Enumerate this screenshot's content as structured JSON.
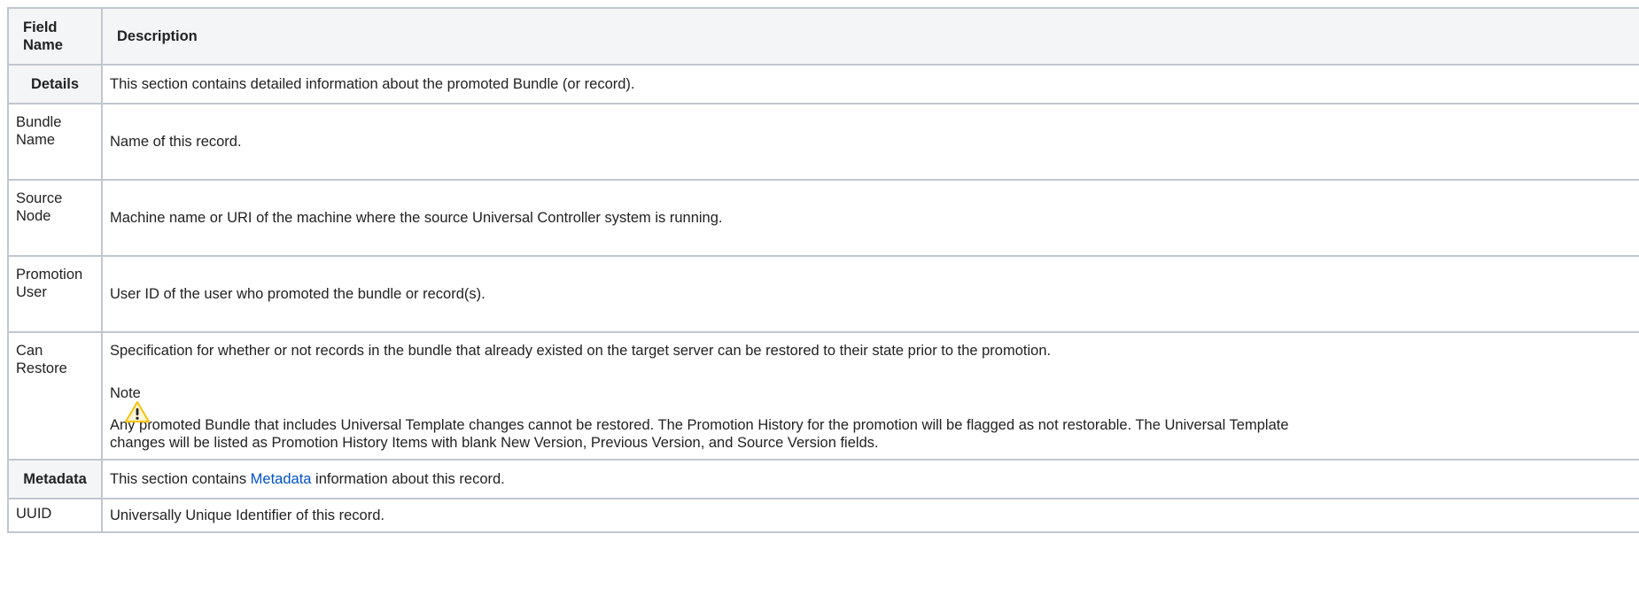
{
  "headers": {
    "field_name": "Field Name",
    "description": "Description"
  },
  "rows": {
    "details": {
      "label": "Details",
      "description": "This section contains detailed information about the promoted Bundle (or record)."
    },
    "bundle_name": {
      "label": "Bundle Name",
      "description": "Name of this record."
    },
    "source_node": {
      "label": "Source Node",
      "description": "Machine name or URI of the machine where the source Universal Controller system is running."
    },
    "promotion_user": {
      "label": "Promotion User",
      "description": "User ID of the user who promoted the bundle or record(s)."
    },
    "can_restore": {
      "label": "Can Restore",
      "description": "Specification for whether or not records in the bundle that already existed on the target server can be restored to their state prior to the promotion.",
      "note_title": "Note",
      "note_icon": "warning-icon",
      "note_text": "Any promoted Bundle that includes Universal Template changes cannot be restored. The Promotion History for the promotion will be flagged as not restorable. The Universal Template changes will be listed as Promotion History Items with blank New Version, Previous Version, and Source Version fields."
    },
    "metadata": {
      "label": "Metadata",
      "description_prefix": "This section contains ",
      "link_text": "Metadata",
      "description_suffix": " information about this record."
    },
    "uuid": {
      "label": "UUID",
      "description": "Universally Unique Identifier of this record."
    }
  },
  "colors": {
    "border": "#c1c7d0",
    "header_bg": "#f4f5f7",
    "link": "#0052cc",
    "warning": "#f5c518"
  }
}
